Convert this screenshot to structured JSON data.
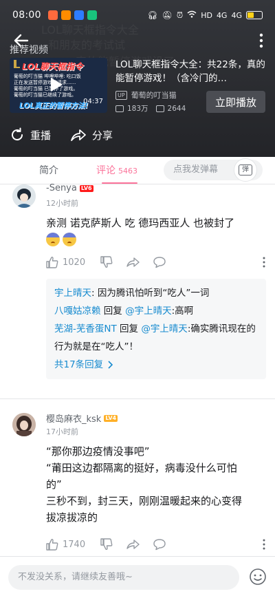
{
  "status": {
    "time": "08:00",
    "network": "HD",
    "signal_a": "4G",
    "signal_b": "4G"
  },
  "header": {
    "recommended_label": "推荐视频",
    "video": {
      "thumb_title": "LOL聊天框指令",
      "thumb_lines": [
        "葡萄的叮当猫 哔哩哔哩: 吃口饭",
        "正在发送暂停游戏的请求......",
        "葡萄的叮当猫 已暂停了游戏。",
        "葡萄的叮当猫已继续了游戏。"
      ],
      "thumb_banner": "LOL真正的暂停方法!",
      "duration": "04:37",
      "title": "LOL聊天框指令大全：共22条，真的能暂停游戏！（含冷门的…",
      "up_tag": "UP",
      "author": "葡萄的叮当猫",
      "plays": "183万",
      "danmaku": "2644",
      "play_button": "立即播放"
    },
    "replay_label": "重播",
    "share_label": "分享"
  },
  "tabs": {
    "intro": "简介",
    "comments": "评论",
    "comment_count": "5463",
    "danmaku_placeholder": "点我发弹幕",
    "danmaku_toggle": "弹"
  },
  "comments": [
    {
      "user": "-Senya",
      "level": "LV6",
      "time": "12小时前",
      "text": "亲测 诺克萨斯人 吃 德玛西亚人 也被封了",
      "likes": "1020",
      "replies": [
        {
          "user": "宇上晴天",
          "sep": ": ",
          "text": "因为腾讯怕听到“吃人”一词"
        },
        {
          "user": "八嘎姑凉赖",
          "reply_word": " 回复 ",
          "target": "@宇上晴天",
          "sep": ":",
          "text": "高啊"
        },
        {
          "user": "芜湖-芜香蛋NT",
          "reply_word": " 回复 ",
          "target": "@宇上晴天",
          "sep": ":",
          "text": "确实腾讯现在的行为就是在“吃人”！"
        }
      ],
      "more_replies": "共17条回复"
    },
    {
      "user": "樱岛麻衣_ksk",
      "level": "LV4",
      "time": "17小时前",
      "lines": [
        "“那你那边疫情没事吧”",
        "“莆田这边都隔离的挺好，病毒没什么可怕",
        "的”",
        "三秒不到，封三天，刚刚温暖起来的心变得",
        "拔凉拔凉的"
      ],
      "likes": "1740"
    }
  ],
  "input": {
    "placeholder": "不发没关系，请继续友善哦~"
  },
  "colors": {
    "accent": "#fb7299",
    "link": "#178bcf",
    "header_bg": "#2b2d31"
  }
}
